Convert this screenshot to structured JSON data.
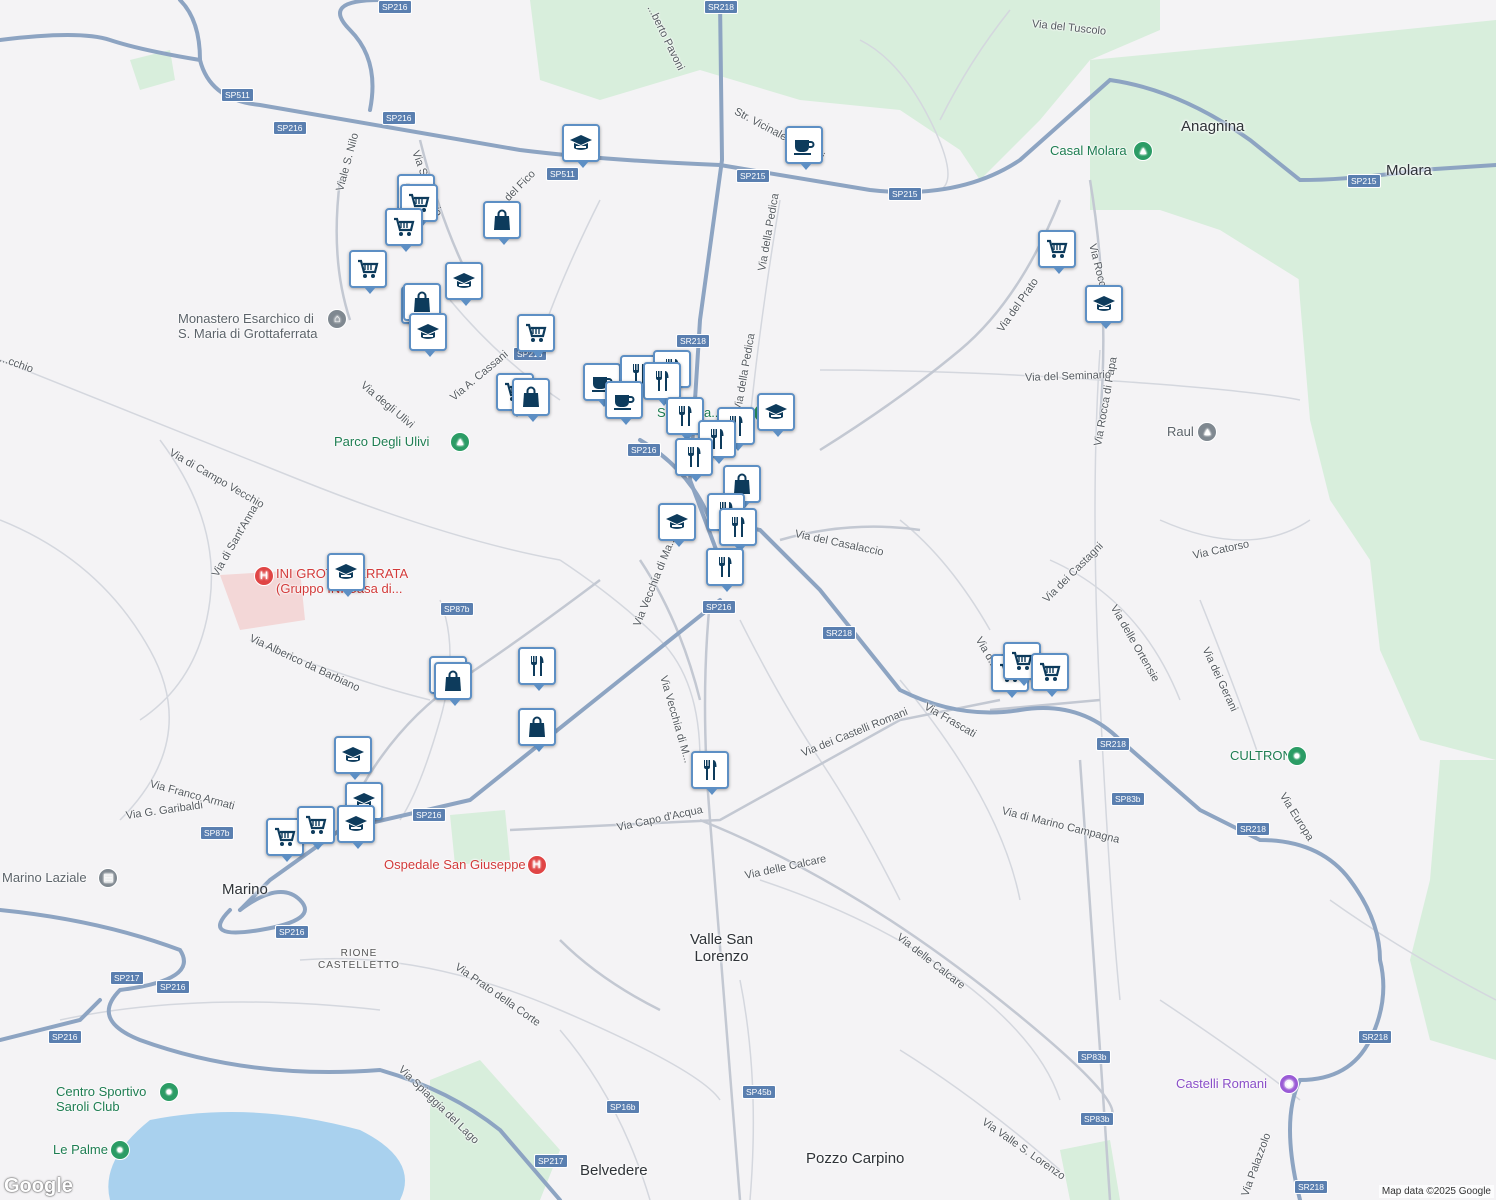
{
  "map": {
    "attribution": "Map data ©2025 Google",
    "logo": "Google",
    "colors": {
      "background": "#f4f3f5",
      "park": "#d8eedc",
      "water": "#a9d1ee",
      "highway": "#8da4c2",
      "road": "#c9cdd6",
      "marker_border": "#5d8fc4",
      "marker_icon": "#0d3b5c"
    }
  },
  "places": [
    {
      "id": "anagnina",
      "name": "Anagnina"
    },
    {
      "id": "molara",
      "name": "Molara"
    },
    {
      "id": "valle-san-lorenzo",
      "name": "Valle San\nLorenzo"
    },
    {
      "id": "marino",
      "name": "Marino"
    },
    {
      "id": "rione-castelletto",
      "name": "RIONE\nCASTELLETTO"
    },
    {
      "id": "belvedere",
      "name": "Belvedere"
    },
    {
      "id": "pozzo-carpino",
      "name": "Pozzo Carpino"
    }
  ],
  "pois": [
    {
      "id": "casal-molara",
      "name": "Casal Molara",
      "kind": "park"
    },
    {
      "id": "monastero",
      "name": "Monastero Esarchico di\nS. Maria di Grottaferrata",
      "kind": "landmark"
    },
    {
      "id": "parco-ulivi",
      "name": "Parco Degli Ulivi",
      "kind": "park"
    },
    {
      "id": "ini-grottaferrata",
      "name": "INI GROTTAFERRATA\n(Gruppo INI Casa di...",
      "kind": "hospital"
    },
    {
      "id": "ospedale",
      "name": "Ospedale San Giuseppe",
      "kind": "hospital"
    },
    {
      "id": "raul",
      "name": "Raul",
      "kind": "school"
    },
    {
      "id": "cultrona",
      "name": "CULTRONA",
      "kind": "park"
    },
    {
      "id": "marino-laziale",
      "name": "Marino Laziale",
      "kind": "station"
    },
    {
      "id": "centro-sportivo",
      "name": "Centro Sportivo\nSaroli Club",
      "kind": "park"
    },
    {
      "id": "le-palme",
      "name": "Le Palme",
      "kind": "park"
    },
    {
      "id": "castelli-romani",
      "name": "Castelli Romani",
      "kind": "attraction"
    },
    {
      "id": "piazza",
      "name": "Sp...azza...ta",
      "kind": "park"
    }
  ],
  "streets": [
    {
      "id": "via-tuscolo",
      "name": "Via del Tuscolo"
    },
    {
      "id": "oberto-pavoni",
      "name": "...berto Pavoni"
    },
    {
      "id": "str-vicinale",
      "name": "Str. Vicinale ... ardini"
    },
    {
      "id": "via-pedica-1",
      "name": "Via della Pedica"
    },
    {
      "id": "via-pedica-2",
      "name": "Via della Pedica"
    },
    {
      "id": "viale-nilo",
      "name": "Viale S. Nilo"
    },
    {
      "id": "via-s-antonio",
      "name": "Via S. Antonio"
    },
    {
      "id": "via-fico",
      "name": "...del Fico"
    },
    {
      "id": "via-cassani",
      "name": "Via A. Cassani"
    },
    {
      "id": "via-ulivi",
      "name": "Via degli Ulivi"
    },
    {
      "id": "via-campo-vecchio",
      "name": "Via di Campo Vecchio"
    },
    {
      "id": "via-santanna",
      "name": "Via di Sant'Anna"
    },
    {
      "id": "via-alberico",
      "name": "Via Alberico da Barbiano"
    },
    {
      "id": "via-franco-armati",
      "name": "Via Franco Armati"
    },
    {
      "id": "via-garibaldi",
      "name": "Via G. Garibaldi"
    },
    {
      "id": "via-vecchia-1",
      "name": "Via Vecchia di Ma..."
    },
    {
      "id": "via-vecchia-2",
      "name": "Via Vecchia di M..."
    },
    {
      "id": "via-casalaccio",
      "name": "Via del Casalaccio"
    },
    {
      "id": "via-castelli-romani",
      "name": "Via dei Castelli Romani"
    },
    {
      "id": "via-frascati",
      "name": "Via Frascati"
    },
    {
      "id": "via-capo-acqua",
      "name": "Via Capo d'Acqua"
    },
    {
      "id": "via-calcare-1",
      "name": "Via delle Calcare"
    },
    {
      "id": "via-calcare-2",
      "name": "Via delle Calcare"
    },
    {
      "id": "via-marino-campagna",
      "name": "Via di Marino Campagna"
    },
    {
      "id": "via-prato",
      "name": "Via del Prato"
    },
    {
      "id": "via-rocca-1",
      "name": "Via Rocca ..."
    },
    {
      "id": "via-rocca-2",
      "name": "Via Rocca di Papa"
    },
    {
      "id": "via-seminario",
      "name": "Via del Seminario"
    },
    {
      "id": "via-castagni",
      "name": "Via dei Castagni"
    },
    {
      "id": "via-catorso",
      "name": "Via Catorso"
    },
    {
      "id": "via-ortensie",
      "name": "Via delle Ortensie"
    },
    {
      "id": "via-gerani",
      "name": "Via dei Gerani"
    },
    {
      "id": "via-europa",
      "name": "Via Europa"
    },
    {
      "id": "via-prato-corte",
      "name": "Via Prato della Corte"
    },
    {
      "id": "via-spiaggia",
      "name": "Via Spiaggia del Lago"
    },
    {
      "id": "via-valle",
      "name": "Via Valle S. Lorenzo"
    },
    {
      "id": "via-palazzolo",
      "name": "Via Palazzolo"
    },
    {
      "id": "via-de",
      "name": "Via d..."
    },
    {
      "id": "via-vecchio",
      "name": "...cchio"
    }
  ],
  "shields": [
    "SP216",
    "SP511",
    "SP216",
    "SP216",
    "SR218",
    "SP511",
    "SP215",
    "SP215",
    "SP215",
    "SR218",
    "SP216",
    "SP216",
    "SP87b",
    "SR218",
    "SP216",
    "SR218",
    "SP83b",
    "SR218",
    "SP216",
    "SP87b",
    "SP216",
    "SP217",
    "SP216",
    "SP216",
    "SP83b",
    "SP83b",
    "SP217",
    "SP16b",
    "SP45b",
    "SR218",
    "SR218"
  ],
  "markers": [
    {
      "type": "school"
    },
    {
      "type": "cafe"
    },
    {
      "type": "cart"
    },
    {
      "type": "cart"
    },
    {
      "type": "cart"
    },
    {
      "type": "bag"
    },
    {
      "type": "cart"
    },
    {
      "type": "bag"
    },
    {
      "type": "school"
    },
    {
      "type": "bag"
    },
    {
      "type": "school"
    },
    {
      "type": "cart"
    },
    {
      "type": "cart"
    },
    {
      "type": "bag"
    },
    {
      "type": "cafe"
    },
    {
      "type": "restaurant"
    },
    {
      "type": "restaurant"
    },
    {
      "type": "restaurant"
    },
    {
      "type": "cafe"
    },
    {
      "type": "restaurant"
    },
    {
      "type": "restaurant"
    },
    {
      "type": "restaurant"
    },
    {
      "type": "school"
    },
    {
      "type": "restaurant"
    },
    {
      "type": "bag"
    },
    {
      "type": "restaurant"
    },
    {
      "type": "school"
    },
    {
      "type": "restaurant"
    },
    {
      "type": "restaurant"
    },
    {
      "type": "cart"
    },
    {
      "type": "school"
    },
    {
      "type": "school"
    },
    {
      "type": "bag"
    },
    {
      "type": "bag"
    },
    {
      "type": "restaurant"
    },
    {
      "type": "bag"
    },
    {
      "type": "school"
    },
    {
      "type": "school"
    },
    {
      "type": "school"
    },
    {
      "type": "cart"
    },
    {
      "type": "cart"
    },
    {
      "type": "restaurant"
    },
    {
      "type": "cart"
    },
    {
      "type": "cart"
    },
    {
      "type": "cart"
    }
  ]
}
